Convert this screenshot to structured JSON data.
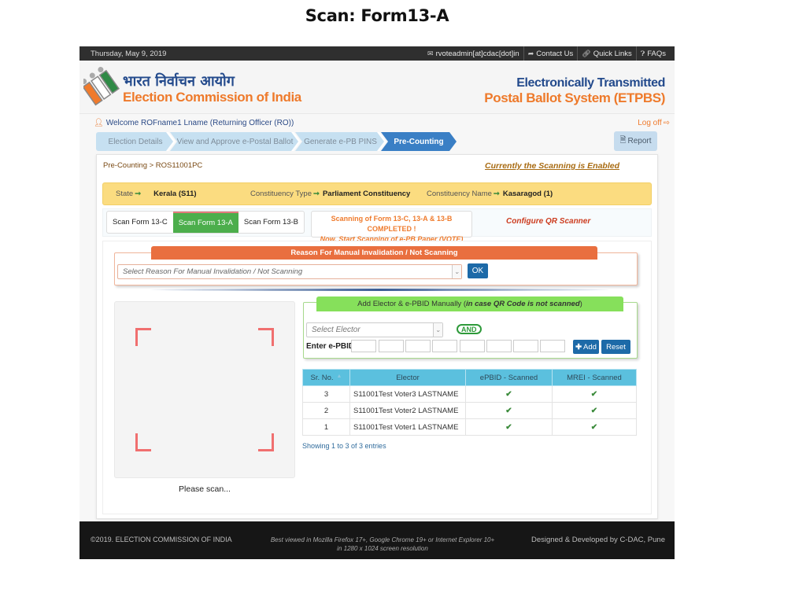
{
  "slide_title": "Scan: Form13-A",
  "topbar": {
    "date": "Thursday, May 9, 2019",
    "links": [
      {
        "icon": "envelope-icon",
        "label": "rvoteadmin[at]cdac[dot]in"
      },
      {
        "icon": "share-icon",
        "label": "Contact Us"
      },
      {
        "icon": "link-icon",
        "label": "Quick Links"
      },
      {
        "icon": "question-circle-icon",
        "label": "FAQs"
      }
    ]
  },
  "header": {
    "hindi_title": "भारत निर्वाचन आयोग",
    "org_name": "Election Commission of India",
    "system_line1": "Electronically Transmitted",
    "system_line2": "Postal Ballot System (ETPBS)",
    "colors": {
      "blue": "#234a8c",
      "orange": "#ee7a2b"
    }
  },
  "welcome": {
    "text": "Welcome ROFname1 Lname (Returning Officer (RO))",
    "logoff": "Log off"
  },
  "wizard": {
    "steps": [
      {
        "label": "Election Details",
        "active": false
      },
      {
        "label": "View and Approve e-Postal Ballot",
        "active": false
      },
      {
        "label": "Generate e-PB PINS",
        "active": false
      },
      {
        "label": "Pre-Counting",
        "active": true
      }
    ],
    "report_label": "Report"
  },
  "main": {
    "breadcrumb": "Pre-Counting > ROS11001PC",
    "scan_status": "Currently the Scanning is Enabled",
    "info": [
      {
        "label": "State",
        "value": "Kerala  (S11)"
      },
      {
        "label": "Constituency Type",
        "value": "Parliament Constituency"
      },
      {
        "label": "Constituency Name",
        "value": "Kasaragod  (1)"
      }
    ],
    "form_tabs": [
      {
        "label": "Scan Form 13-C",
        "active": false
      },
      {
        "label": "Scan Form 13-A",
        "active": true
      },
      {
        "label": "Scan Form 13-B",
        "active": false
      }
    ],
    "completed_line1": "Scanning of Form 13-C, 13-A & 13-B COMPLETED !",
    "completed_line2": "Now, Start Scanning of e-PB Paper (VOTE)",
    "configure_qr": "Configure QR Scanner"
  },
  "reason": {
    "title": "Reason For Manual Invalidation / Not Scanning",
    "placeholder": "Select Reason For Manual Invalidation / Not Scanning",
    "ok_label": "OK"
  },
  "scanner": {
    "prompt": "Please scan..."
  },
  "manual_add": {
    "title_main": "Add Elector & e-PBID Manually (",
    "title_italic": "in case QR Code is not scanned",
    "title_end": ")",
    "elector_placeholder": "Select Elector",
    "and_label": "AND",
    "epbid_label": "Enter e-PBID:",
    "epbid_values": [
      "",
      "",
      "",
      "",
      "",
      "",
      "",
      ""
    ],
    "add_label": "Add",
    "reset_label": "Reset"
  },
  "table": {
    "headers": [
      "Sr. No.",
      "Elector",
      "ePBID - Scanned",
      "MREI - Scanned"
    ],
    "rows": [
      {
        "sr": "3",
        "elector": "S11001Test Voter3 LASTNAME",
        "epbid_scanned": true,
        "mrei_scanned": true
      },
      {
        "sr": "2",
        "elector": "S11001Test Voter2 LASTNAME",
        "epbid_scanned": true,
        "mrei_scanned": true
      },
      {
        "sr": "1",
        "elector": "S11001Test Voter1 LASTNAME",
        "epbid_scanned": true,
        "mrei_scanned": true
      }
    ],
    "check_glyph": "✔",
    "showing": "Showing 1 to 3 of 3 entries"
  },
  "footer": {
    "copyright": "©2019. ELECTION COMMISSION OF INDIA",
    "best_viewed_line1": "Best viewed in Mozilla Firefox 17+, Google Chrome 19+ or Internet Explorer 10+",
    "best_viewed_line2": "in 1280 x 1024 screen resolution",
    "developer": "Designed & Developed by C-DAC, Pune"
  }
}
